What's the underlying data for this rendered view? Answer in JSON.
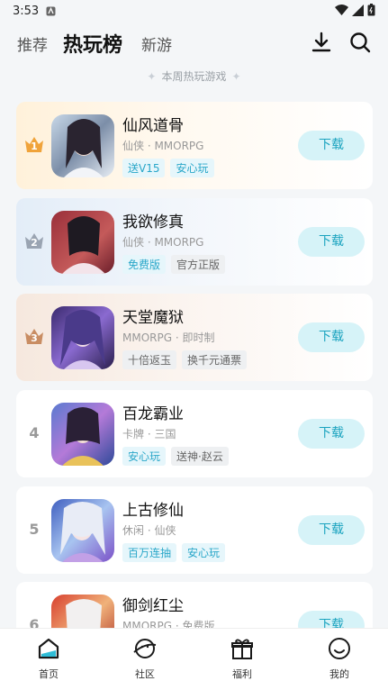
{
  "status": {
    "time": "3:53"
  },
  "tabs": [
    {
      "label": "推荐"
    },
    {
      "label": "热玩榜"
    },
    {
      "label": "新游"
    }
  ],
  "subtitle": "本周热玩游戏",
  "games": [
    {
      "rank": "1",
      "title": "仙风道骨",
      "meta": "仙侠 · MMORPG",
      "tags": [
        "送V15",
        "安心玩"
      ],
      "button": "下载"
    },
    {
      "rank": "2",
      "title": "我欲修真",
      "meta": "仙侠 · MMORPG",
      "tags": [
        "免费版",
        "官方正版"
      ],
      "button": "下载"
    },
    {
      "rank": "3",
      "title": "天堂魔狱",
      "meta": "MMORPG · 即时制",
      "tags": [
        "十倍返玉",
        "换千元通票"
      ],
      "button": "下载"
    },
    {
      "rank": "4",
      "title": "百龙霸业",
      "meta": "卡牌 · 三国",
      "tags": [
        "安心玩",
        "送神·赵云"
      ],
      "button": "下载"
    },
    {
      "rank": "5",
      "title": "上古修仙",
      "meta": "休闲 · 仙侠",
      "tags": [
        "百万连抽",
        "安心玩"
      ],
      "button": "下载"
    },
    {
      "rank": "6",
      "title": "御剑红尘",
      "meta": "MMORPG · 免费版",
      "tags": [],
      "button": "下载"
    }
  ],
  "bottom_nav": [
    {
      "label": "首页",
      "icon": "home-icon"
    },
    {
      "label": "社区",
      "icon": "community-icon"
    },
    {
      "label": "福利",
      "icon": "gift-icon"
    },
    {
      "label": "我的",
      "icon": "profile-icon"
    }
  ],
  "colors": {
    "accent": "#1aa3bf",
    "button_bg": "#d6f3f8",
    "gold": "#f0a33a",
    "silver": "#9aa4b2",
    "bronze": "#c98d63"
  }
}
